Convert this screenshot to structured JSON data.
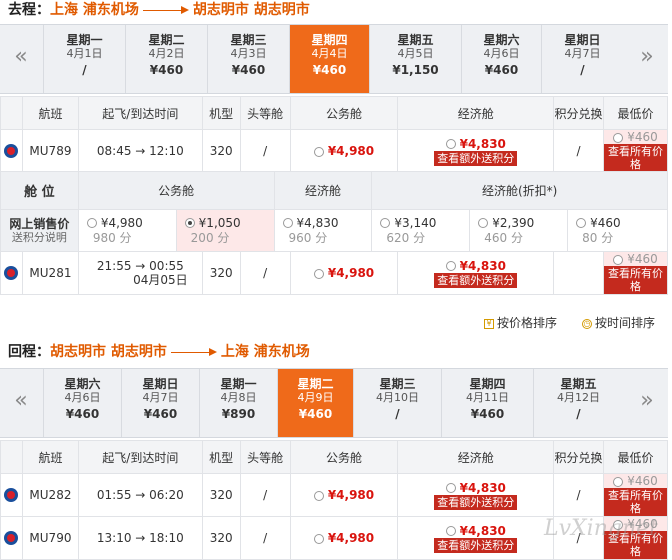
{
  "outbound": {
    "label": "去程：",
    "from": "上海 浦东机场",
    "to": "胡志明市 胡志明市",
    "days": [
      {
        "weekday": "星期一",
        "date": "4月1日",
        "price": "/"
      },
      {
        "weekday": "星期二",
        "date": "4月2日",
        "price": "¥460"
      },
      {
        "weekday": "星期三",
        "date": "4月3日",
        "price": "¥460"
      },
      {
        "weekday": "星期四",
        "date": "4月4日",
        "price": "¥460"
      },
      {
        "weekday": "星期五",
        "date": "4月5日",
        "price": "¥1,150"
      },
      {
        "weekday": "星期六",
        "date": "4月6日",
        "price": "¥460"
      },
      {
        "weekday": "星期日",
        "date": "4月7日",
        "price": "/"
      }
    ]
  },
  "return": {
    "label": "回程：",
    "from": "胡志明市 胡志明市",
    "to": "上海 浦东机场",
    "days": [
      {
        "weekday": "星期六",
        "date": "4月6日",
        "price": "¥460"
      },
      {
        "weekday": "星期日",
        "date": "4月7日",
        "price": "¥460"
      },
      {
        "weekday": "星期一",
        "date": "4月8日",
        "price": "¥890"
      },
      {
        "weekday": "星期二",
        "date": "4月9日",
        "price": "¥460"
      },
      {
        "weekday": "星期三",
        "date": "4月10日",
        "price": "/"
      },
      {
        "weekday": "星期四",
        "date": "4月11日",
        "price": "¥460"
      },
      {
        "weekday": "星期五",
        "date": "4月12日",
        "price": "/"
      }
    ]
  },
  "headers": {
    "flight": "航班",
    "time": "起飞/到达时间",
    "aircraft": "机型",
    "first": "头等舱",
    "business": "公务舱",
    "economy": "经济舱",
    "points": "积分兑换",
    "lowest": "最低价"
  },
  "out_flights": [
    {
      "no": "MU789",
      "time": "08:45 → 12:10",
      "type": "320",
      "first": "/",
      "business": "¥4,980",
      "economy": "¥4,830",
      "points": "/",
      "lowest": "¥460"
    }
  ],
  "fare_detail": {
    "cabin_label": "舱 位",
    "business_label": "公务舱",
    "economy_label": "经济舱",
    "discount_label": "经济舱(折扣*)",
    "online_label": "网上销售价",
    "points_label": "送积分说明",
    "fares": [
      {
        "price": "¥4,980",
        "pts": "980 分"
      },
      {
        "price": "¥1,050",
        "pts": "200 分"
      },
      {
        "price": "¥4,830",
        "pts": "960 分"
      },
      {
        "price": "¥3,140",
        "pts": "620 分"
      },
      {
        "price": "¥2,390",
        "pts": "460 分"
      },
      {
        "price": "¥460",
        "pts": "80 分"
      }
    ],
    "flight": {
      "no": "MU281",
      "time": "21:55 → 00:55",
      "arrive_date": "04月05日",
      "type": "320",
      "business": "¥4,980",
      "economy": "¥4,830",
      "lowest": "¥460"
    }
  },
  "extra_points_btn": "查看额外送积分",
  "all_prices_btn": "查看所有价格",
  "sort_price": "按价格排序",
  "sort_time": "按时间排序",
  "ret_flights": [
    {
      "no": "MU282",
      "time": "01:55 → 06:20",
      "type": "320",
      "first": "/",
      "business": "¥4,980",
      "economy": "¥4,830",
      "points": "/",
      "lowest": "¥460"
    },
    {
      "no": "MU790",
      "time": "13:10 → 18:10",
      "type": "320",
      "first": "/",
      "business": "¥4,980",
      "economy": "¥4,830",
      "points": "/",
      "lowest": "¥460"
    }
  ],
  "watermark": "LvXingnet",
  "colors": {
    "accent": "#ef6a1a",
    "price_red": "#d9140e",
    "button_red": "#c42a1e"
  }
}
